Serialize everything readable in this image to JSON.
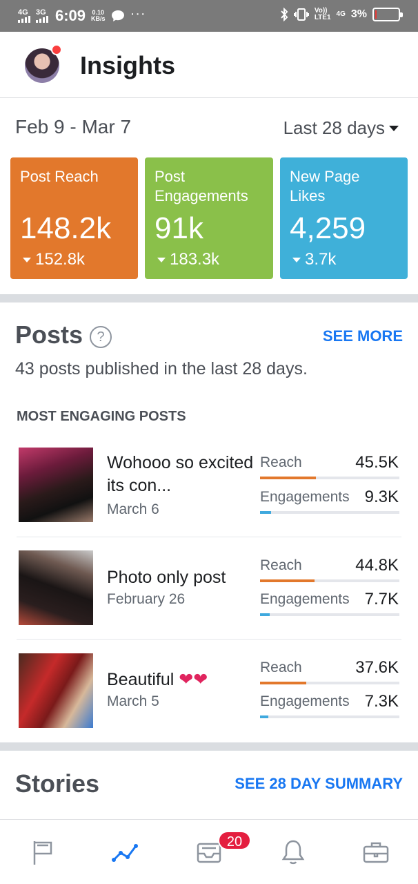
{
  "status_bar": {
    "sim1": "4G",
    "sim2": "3G",
    "time": "6:09",
    "speed_value": "0.10",
    "speed_unit": "KB/s",
    "volte": "Vo))",
    "lte": "LTE1",
    "net4g": "4G",
    "battery_percent": "3%",
    "battery_level": 0.03
  },
  "header": {
    "title": "Insights"
  },
  "overview": {
    "date_range": "Feb 9 - Mar 7",
    "period": "Last 28 days"
  },
  "metrics": [
    {
      "label": "Post Reach",
      "value": "148.2k",
      "delta": "152.8k",
      "color": "#e2782c"
    },
    {
      "label": "Post Engagements",
      "value": "91k",
      "delta": "183.3k",
      "color": "#8ac04a"
    },
    {
      "label": "New Page Likes",
      "value": "4,259",
      "delta": "3.7k",
      "color": "#3fb0d9"
    }
  ],
  "posts": {
    "title": "Posts",
    "help_symbol": "?",
    "see_more": "SEE MORE",
    "summary": "43 posts published in the last 28 days.",
    "section_label": "MOST ENGAGING POSTS",
    "items": [
      {
        "text": "Wohooo so excited its con...",
        "date": "March 6",
        "reach_label": "Reach",
        "reach": "45.5K",
        "reach_fraction": 0.4,
        "eng_label": "Engagements",
        "engagements": "9.3K",
        "eng_fraction": 0.08
      },
      {
        "text": "Photo only post",
        "date": "February 26",
        "reach_label": "Reach",
        "reach": "44.8K",
        "reach_fraction": 0.39,
        "eng_label": "Engagements",
        "engagements": "7.7K",
        "eng_fraction": 0.07
      },
      {
        "text": "Beautiful",
        "date": "March 5",
        "reach_label": "Reach",
        "reach": "37.6K",
        "reach_fraction": 0.33,
        "eng_label": "Engagements",
        "engagements": "7.3K",
        "eng_fraction": 0.06
      }
    ]
  },
  "stories": {
    "title": "Stories",
    "see_summary": "SEE 28 DAY SUMMARY"
  },
  "bottom_nav": {
    "badge": "20",
    "active_color": "#1877f2",
    "items": [
      "flag-icon",
      "insights-icon",
      "inbox-icon",
      "bell-icon",
      "briefcase-icon"
    ]
  },
  "colors": {
    "reach_bar": "#e2782c",
    "engagement_bar": "#3fa9de",
    "link": "#1877f2"
  }
}
